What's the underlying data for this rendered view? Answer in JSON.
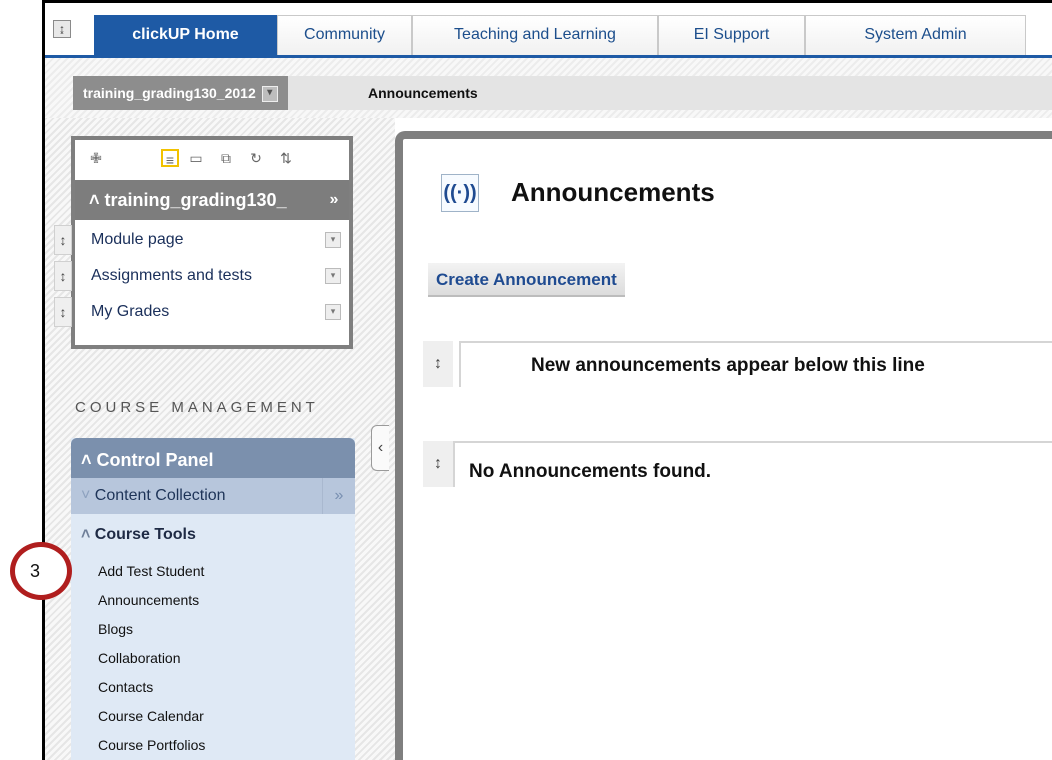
{
  "tabs": [
    {
      "label": "clickUP Home",
      "active": true
    },
    {
      "label": "Community"
    },
    {
      "label": "Teaching and Learning"
    },
    {
      "label": "EI Support"
    },
    {
      "label": "System Admin"
    }
  ],
  "toggle_icon": "↨",
  "breadcrumb": {
    "course": "training_grading130_2012",
    "page": "Announcements"
  },
  "course_menu": {
    "title": "training_grading130_",
    "items": [
      {
        "label": "Module page"
      },
      {
        "label": "Assignments and tests"
      },
      {
        "label": "My Grades"
      }
    ]
  },
  "course_management": {
    "heading": "COURSE MANAGEMENT",
    "control_panel": "Control Panel",
    "content_collection": "Content Collection",
    "course_tools": "Course Tools",
    "links": [
      "Add Test Student",
      "Announcements",
      "Blogs",
      "Collaboration",
      "Contacts",
      "Course Calendar",
      "Course Portfolios"
    ]
  },
  "main": {
    "title": "Announcements",
    "create_button": "Create Announcement",
    "separator_text": "New announcements appear below this line",
    "empty_text": "No Announcements found."
  },
  "callout": {
    "label": "3",
    "color": "#b01e1e"
  },
  "colors": {
    "brand_blue": "#1e5aa5",
    "panel_blue": "#7b90ad"
  }
}
